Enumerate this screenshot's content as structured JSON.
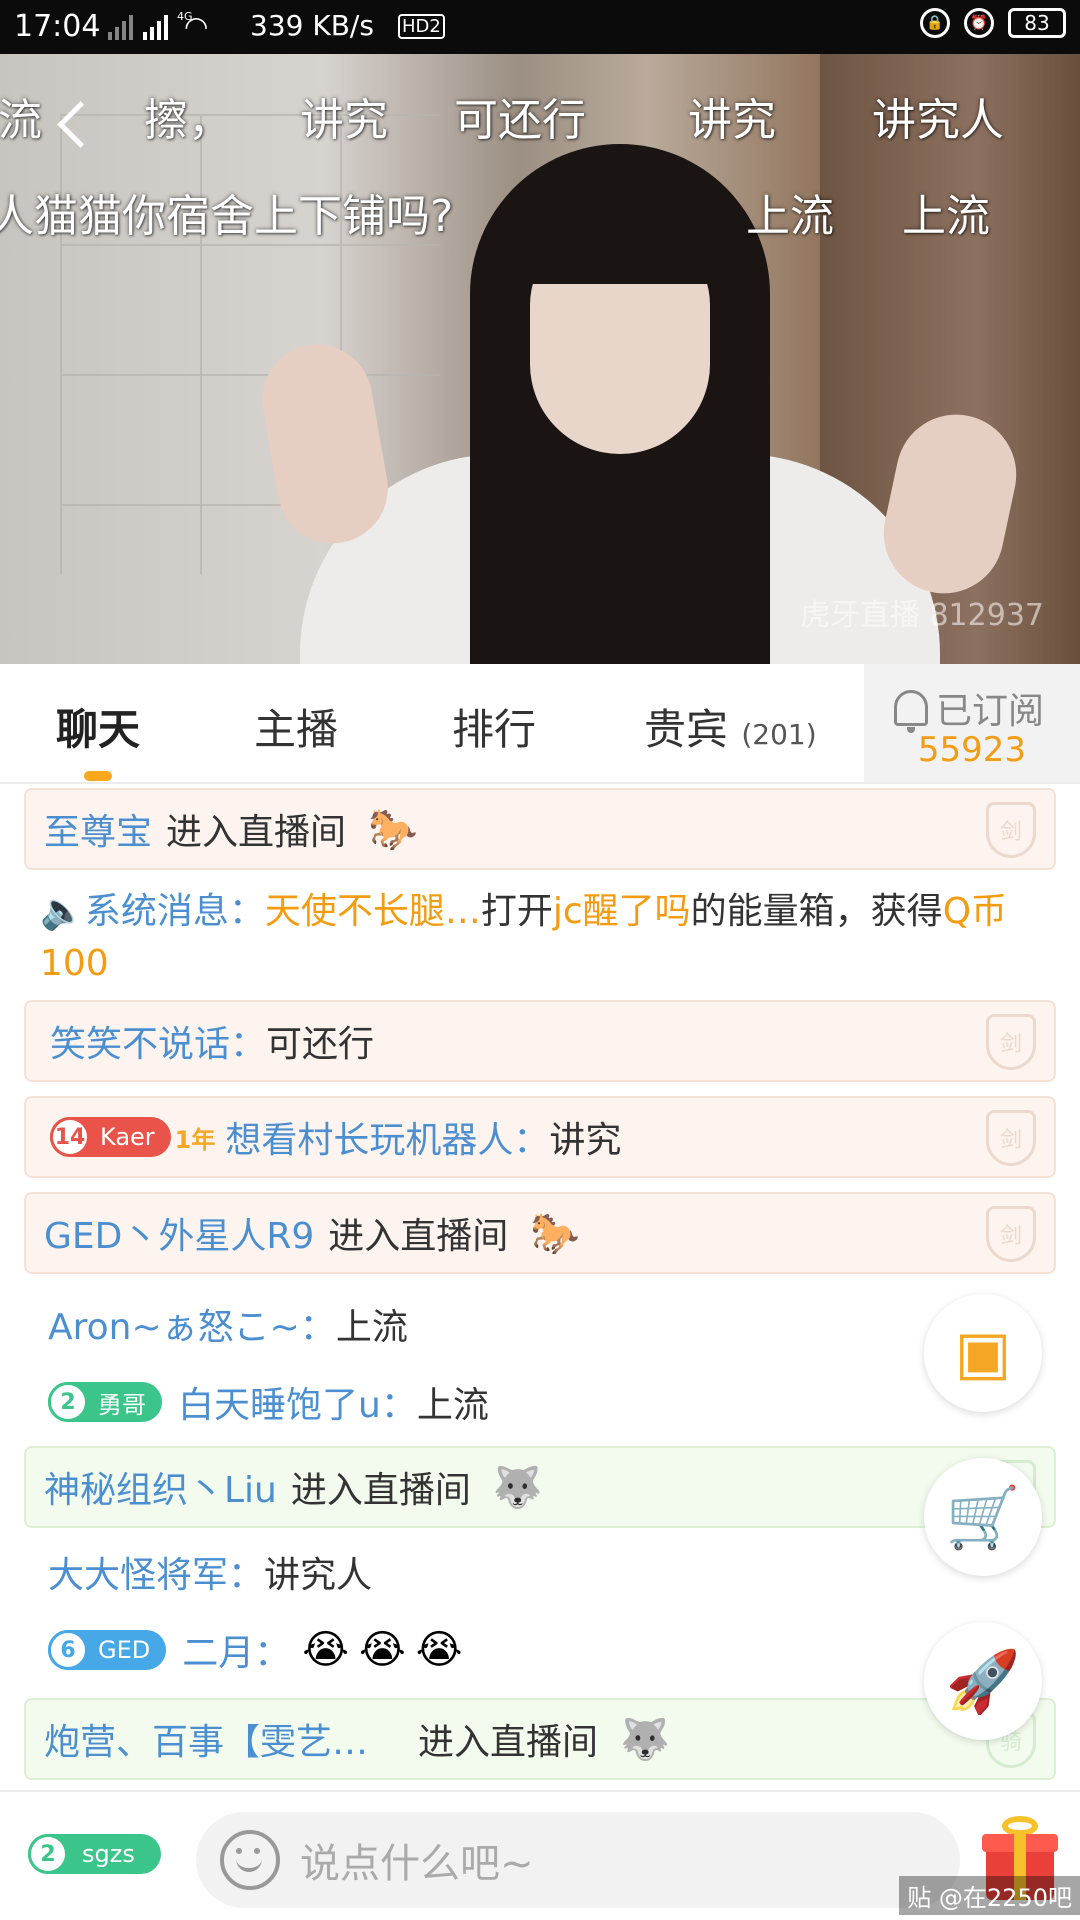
{
  "status_bar": {
    "time": "17:04",
    "network_tag": "4G",
    "speed": "339 KB/s",
    "hd_label": "HD2",
    "battery": "83"
  },
  "video": {
    "watermark": "虎牙直播 812937",
    "danmaku": [
      "流",
      "擦，",
      "讲究",
      "可还行",
      "讲究",
      "讲究人",
      "人猫猫你宿舍上下铺吗?",
      "上流",
      "上流"
    ]
  },
  "tabs": [
    {
      "label": "聊天",
      "active": true
    },
    {
      "label": "主播"
    },
    {
      "label": "排行"
    },
    {
      "label": "贵宾",
      "count": "(201)"
    }
  ],
  "subscribe": {
    "label": "已订阅",
    "count": "55923"
  },
  "chat": {
    "m1": {
      "name": "至尊宝",
      "action": "进入直播间",
      "mount": "horse-icon"
    },
    "sys": {
      "prefix": "系统消息：",
      "user": "天使不长腿…",
      "t1": "打开",
      "host": "jc醒了吗",
      "t2": "的能量箱，获得",
      "prize": "Q币100"
    },
    "m2": {
      "name": "笑笑不说话：",
      "text": "可还行"
    },
    "m3": {
      "badge_level": "14",
      "badge_name": "Kaer",
      "badge_suffix": "1年",
      "name": "想看村长玩机器人：",
      "text": "讲究"
    },
    "m4": {
      "name": "GED丶外星人R9",
      "action": "进入直播间"
    },
    "m5": {
      "name": "Aron~ぁ怒こ~：",
      "text": "上流"
    },
    "m6": {
      "badge_level": "2",
      "badge_name": "勇哥",
      "name": "白天睡饱了u：",
      "text": "上流"
    },
    "m7": {
      "name": "神秘组织丶Liu",
      "action": "进入直播间"
    },
    "m8": {
      "name": "大大怪将军：",
      "text": "讲究人"
    },
    "m9": {
      "badge_level": "6",
      "badge_name": "GED",
      "name": "二月：",
      "emojis": [
        "😭",
        "😭",
        "😭"
      ]
    },
    "m10": {
      "name": "炮营、百事【雯艺…",
      "action": "进入直播间"
    },
    "shield_glyph": "剑",
    "shield_glyph_alt": "骑"
  },
  "bottom": {
    "badge_level": "2",
    "badge_name": "sgzs",
    "placeholder": "说点什么吧~",
    "footer_tag": "贴 @在2250吧"
  },
  "colors": {
    "accent_orange": "#f39c12",
    "name_blue": "#4c8fd1",
    "badge_red": "#e9534a",
    "badge_green": "#3cc58a",
    "badge_blue": "#46a8e6"
  }
}
